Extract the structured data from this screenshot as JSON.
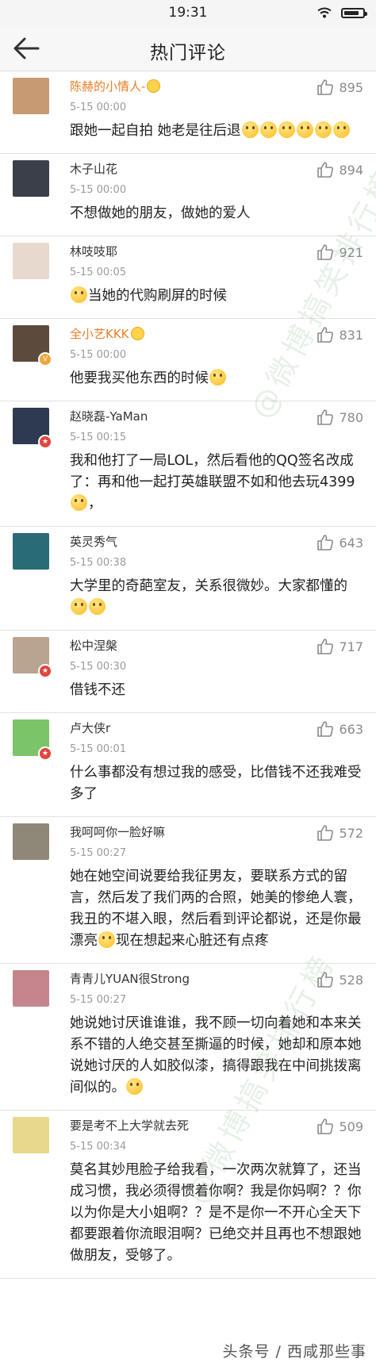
{
  "status": {
    "time": "19:31"
  },
  "nav": {
    "title": "热门评论"
  },
  "comments": [
    {
      "name": "陈赫的小情人-",
      "vip": true,
      "time": "5-15 00:00",
      "likes": "895",
      "pre": "",
      "text": "跟她一起自拍 她老是往后退",
      "emojis": 6,
      "badge": "",
      "avatar_color": "#c79a74"
    },
    {
      "name": "木子山花",
      "vip": false,
      "time": "5-15 00:00",
      "likes": "894",
      "pre": "",
      "text": "不想做她的朋友，做她的爱人",
      "emojis": 0,
      "badge": "",
      "avatar_color": "#3b3f4a"
    },
    {
      "name": "林吱吱耶",
      "vip": false,
      "time": "5-15 00:05",
      "likes": "921",
      "pre": "emoji",
      "text": "当她的代购刷屏的时候",
      "emojis": 0,
      "badge": "",
      "avatar_color": "#e8d9cf"
    },
    {
      "name": "全小艺KKK",
      "vip": true,
      "time": "5-15 00:00",
      "likes": "831",
      "pre": "",
      "text": "他要我买他东西的时候",
      "emojis": 1,
      "badge": "V",
      "avatar_color": "#5c4a3c"
    },
    {
      "name": "赵晓磊-YaMan",
      "vip": false,
      "time": "5-15 00:15",
      "likes": "780",
      "pre": "",
      "text": "我和他打了一局LOL，然后看他的QQ签名改成了：再和他一起打英雄联盟不如和他去玩4399",
      "emojis": 1,
      "tail": "，",
      "badge": "red",
      "avatar_color": "#2d3a52"
    },
    {
      "name": "英灵秀气",
      "vip": false,
      "time": "5-15 00:38",
      "likes": "643",
      "pre": "",
      "text": "大学里的奇葩室友，关系很微妙。大家都懂的",
      "emojis": 2,
      "badge": "",
      "avatar_color": "#2a6b78"
    },
    {
      "name": "松中涅槃",
      "vip": false,
      "time": "5-15 00:30",
      "likes": "717",
      "pre": "",
      "text": "借钱不还",
      "emojis": 0,
      "badge": "red",
      "avatar_color": "#b9a48f"
    },
    {
      "name": "卢大侠r",
      "vip": false,
      "time": "5-15 00:01",
      "likes": "663",
      "pre": "",
      "text": "什么事都没有想过我的感受，比借钱不还我难受多了",
      "emojis": 0,
      "badge": "red",
      "avatar_color": "#7cc46a"
    },
    {
      "name": "我呵呵你一脸好嘛",
      "vip": false,
      "time": "5-15 00:27",
      "likes": "572",
      "pre": "",
      "text": "她在她空间说要给我征男友，要联系方式的留言，然后发了我们两的合照，她美的惨绝人寰，我丑的不堪入眼，然后看到评论都说，还是你最漂亮",
      "emojis": 1,
      "tail": "现在想起来心脏还有点疼",
      "badge": "",
      "avatar_color": "#8f8778"
    },
    {
      "name": "青青儿YUAN很Strong",
      "vip": false,
      "time": "5-15 00:27",
      "likes": "528",
      "pre": "",
      "text": "她说她讨厌谁谁谁，我不顾一切向着她和本来关系不错的人绝交甚至撕逼的时候，她却和原本她说她讨厌的人如胶似漆，搞得跟我在中间挑拨离间似的。",
      "emojis": 1,
      "badge": "",
      "avatar_color": "#c4868c"
    },
    {
      "name": "要是考不上大学就去死",
      "vip": false,
      "time": "5-15 00:34",
      "likes": "509",
      "pre": "",
      "text": "莫名其妙甩脸子给我看，一次两次就算了，还当成习惯，我必须得惯着你啊？我是你妈啊？？你以为你是大小姐啊？？是不是你一不开心全天下都要跟着你流眼泪啊？已绝交并且再也不想跟她做朋友，受够了。",
      "emojis": 0,
      "badge": "",
      "avatar_color": "#e6d98c"
    }
  ],
  "watermark": "@微博搞笑排行榜",
  "footer": "头条号 / 西咸那些事"
}
